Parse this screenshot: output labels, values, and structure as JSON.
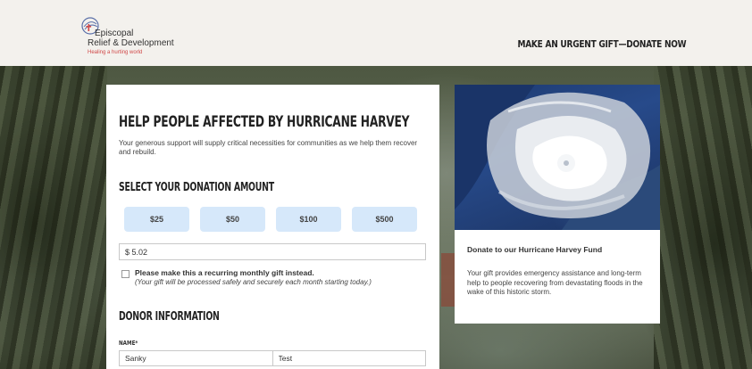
{
  "header": {
    "logo": {
      "line1": "Episcopal",
      "line2": "Relief & Development",
      "tagline": "Healing a hurting world"
    },
    "cta": "MAKE AN URGENT GIFT—DONATE NOW"
  },
  "form": {
    "title": "HELP PEOPLE AFFECTED BY HURRICANE HARVEY",
    "intro": "Your generous support will supply critical necessities for communities as we help them recover and rebuild.",
    "amount_heading": "SELECT YOUR DONATION AMOUNT",
    "amounts": [
      "$25",
      "$50",
      "$100",
      "$500"
    ],
    "other_amount_value": "$ 5.02",
    "recurring_label": "Please make this a recurring monthly gift instead.",
    "recurring_note": "(Your gift will be processed safely and securely each month starting today.)",
    "donor_heading": "DONOR INFORMATION",
    "name_label": "NAME*",
    "first_name_value": "Sanky",
    "last_name_value": "Test"
  },
  "side_card": {
    "title": "Donate to our Hurricane Harvey Fund",
    "body": "Your gift provides emergency assistance and long-term help to people recovering from devastating floods in the wake of this historic storm."
  },
  "colors": {
    "header_bg": "#f3f1ed",
    "amount_button_bg": "#d6e8fa",
    "tagline_red": "#d04848"
  }
}
